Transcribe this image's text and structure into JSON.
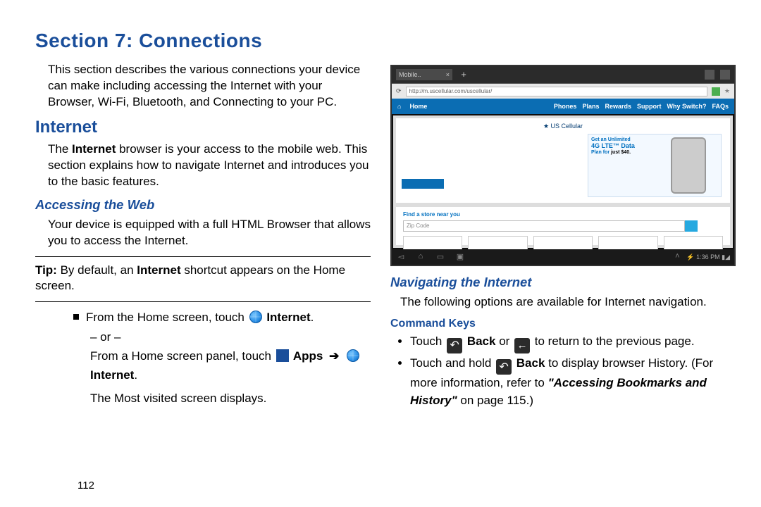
{
  "section_title": "Section 7: Connections",
  "page_number": "112",
  "left": {
    "intro": "This section describes the various connections your device can make including accessing the Internet with your Browser, Wi-Fi, Bluetooth, and Connecting to your PC.",
    "h2_internet": "Internet",
    "internet_body_pre": "The ",
    "internet_bold": "Internet",
    "internet_body_post": " browser is your access to the mobile web. This section explains how to navigate Internet and introduces you to the basic features.",
    "h3_accessing": "Accessing the Web",
    "accessing_body": "Your device is equipped with a full HTML Browser that allows you to access the Internet.",
    "tip_label": "Tip:",
    "tip_pre": " By default, an ",
    "tip_bold": "Internet",
    "tip_post": " shortcut appears on the Home screen.",
    "step_pre": "From the Home screen, touch ",
    "step_internet": " Internet",
    "step_period": ".",
    "or": "– or –",
    "alt_pre": "From a Home screen panel, touch ",
    "alt_apps": " Apps ",
    "alt_arrow": "➔",
    "alt_internet": "Internet",
    "alt_period": ".",
    "most_visited": "The Most visited screen displays."
  },
  "right": {
    "h3_nav": "Navigating the Internet",
    "nav_body": "The following options are available for Internet navigation.",
    "h4_cmd": "Command Keys",
    "b1_pre": "Touch ",
    "b1_back": " Back",
    "b1_or": " or ",
    "b1_post": " to return to the previous page.",
    "b2_pre": "Touch and hold ",
    "b2_back": " Back",
    "b2_mid": " to display browser History. (For more information, refer to ",
    "b2_ref": "\"Accessing Bookmarks and History\"",
    "b2_post": " on page 115.)"
  },
  "screenshot": {
    "tab": "Mobile..",
    "url": "http://m.uscellular.com/uscellular/",
    "nav_home": "Home",
    "nav_items": [
      "Phones",
      "Plans",
      "Rewards",
      "Support",
      "Why Switch?",
      "FAQs"
    ],
    "logo_pre": "★ US",
    "logo_post": "Cellular",
    "promo_line1": "Get an Unlimited",
    "promo_line2": "4G LTE™ Data",
    "promo_line3": "Plan for",
    "promo_price": "just $40.",
    "store_label": "Find a store near you",
    "zip_placeholder": "Zip Code",
    "time": "1:36 PM"
  }
}
